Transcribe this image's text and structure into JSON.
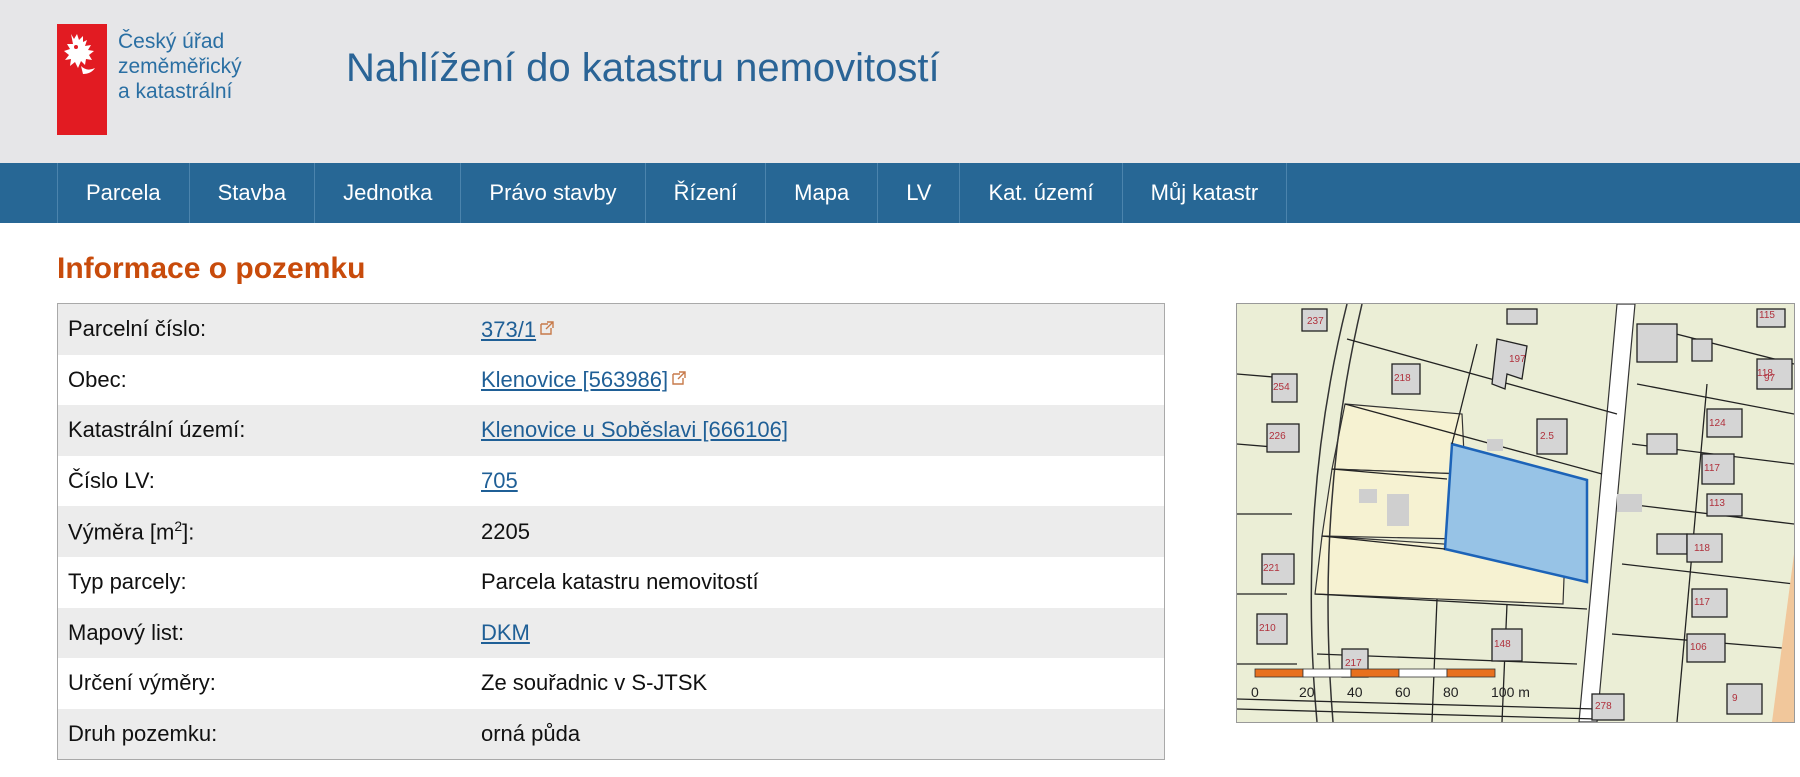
{
  "org": {
    "line1": "Český úřad",
    "line2": "zeměměřický",
    "line3": "a katastrální"
  },
  "site_title": "Nahlížení do katastru nemovitostí",
  "nav": {
    "items": [
      "Parcela",
      "Stavba",
      "Jednotka",
      "Právo stavby",
      "Řízení",
      "Mapa",
      "LV",
      "Kat. území",
      "Můj katastr"
    ]
  },
  "section_title": "Informace o pozemku",
  "parcel": {
    "rows": [
      {
        "label": "Parcelní číslo:",
        "value": "373/1",
        "link": true,
        "ext": true
      },
      {
        "label": "Obec:",
        "value": "Klenovice [563986]",
        "link": true,
        "ext": true
      },
      {
        "label": "Katastrální území:",
        "value": "Klenovice u Soběslavi [666106]",
        "link": true,
        "ext": false
      },
      {
        "label": "Číslo LV:",
        "value": "705",
        "link": true,
        "ext": false
      },
      {
        "label_prefix": "Výměra [m",
        "label_sup": "2",
        "label_suffix": "]:",
        "value": "2205",
        "link": false,
        "ext": false
      },
      {
        "label": "Typ parcely:",
        "value": "Parcela katastru nemovitostí",
        "link": false,
        "ext": false
      },
      {
        "label": "Mapový list:",
        "value": "DKM",
        "link": true,
        "ext": false
      },
      {
        "label": "Určení výměry:",
        "value": "Ze souřadnic v S-JTSK",
        "link": false,
        "ext": false
      },
      {
        "label": "Druh pozemku:",
        "value": "orná půda",
        "link": false,
        "ext": false
      }
    ]
  },
  "map": {
    "scale_labels": [
      "0",
      "20",
      "40",
      "60",
      "80",
      "100 m"
    ],
    "building_numbers": [
      "237",
      "197",
      "115",
      "118",
      "254",
      "218",
      "97",
      "226",
      "2.5",
      "124",
      "117",
      "113",
      "118",
      "221",
      "117",
      "210",
      "217",
      "148",
      "106",
      "278",
      "9"
    ],
    "colors": {
      "selected_parcel": "#97c3e6",
      "selected_outline": "#1c63b8",
      "scale_orange": "#e8701e"
    }
  },
  "colors": {
    "header_bg": "#e6e6e8",
    "nav_bg": "#276795",
    "brand_red": "#e21b22",
    "title_blue": "#2a6496",
    "section_orange": "#c84b0b",
    "link": "#1f5f96"
  }
}
